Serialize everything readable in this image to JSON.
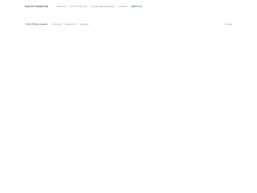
{
  "header": {
    "brand": "PHILIPP OSWALDE",
    "nav": [
      {
        "label": "ABSATZ",
        "active": false
      },
      {
        "label": "STUHTZENTR",
        "active": false
      },
      {
        "label": "SUHEHRENNERKET",
        "active": false
      },
      {
        "label": "PEPES",
        "active": false
      },
      {
        "label": "IMPULSE",
        "active": true
      }
    ]
  },
  "footer": {
    "copyright": "© 2024 Philipp Oswalde",
    "links": [
      "Impressum",
      "Datenschutz",
      "Newsletter"
    ],
    "right_link": "Kontakt"
  },
  "colors": {
    "background": "#ffffff",
    "nav_text": "#888888",
    "nav_active": "#1f6d8a",
    "brand_text": "#333333"
  }
}
